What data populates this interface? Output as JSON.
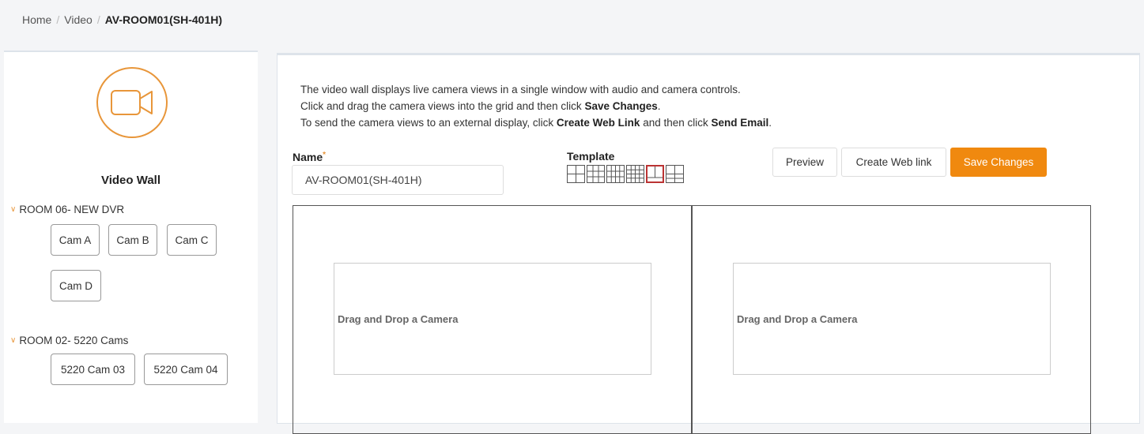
{
  "breadcrumb": {
    "home": "Home",
    "video": "Video",
    "current": "AV-ROOM01(SH-401H)"
  },
  "sidebar": {
    "title": "Video Wall",
    "rooms": [
      {
        "label": "ROOM 06- NEW DVR",
        "cams": [
          "Cam A",
          "Cam B",
          "Cam C",
          "Cam D"
        ]
      },
      {
        "label": "ROOM 02- 5220 Cams",
        "cams": [
          "5220 Cam 03",
          "5220 Cam 04"
        ]
      }
    ]
  },
  "intro": {
    "line1": "The video wall displays live camera views in a single window with audio and camera controls.",
    "line2_pre": "Click and drag the camera views into the grid and then click ",
    "line2_bold": "Save Changes",
    "line2_post": ".",
    "line3_pre": "To send the camera views to an external display, click ",
    "line3_bold1": "Create Web Link",
    "line3_mid": " and then click ",
    "line3_bold2": "Send Email",
    "line3_post": "."
  },
  "form": {
    "name_label": "Name",
    "name_required": "*",
    "name_value": "AV-ROOM01(SH-401H)",
    "template_label": "Template",
    "templates": [
      "2x2",
      "3x3",
      "4x3",
      "4x4",
      "1+2",
      "2x2-alt"
    ],
    "active_template": 4
  },
  "buttons": {
    "preview": "Preview",
    "create_link": "Create Web link",
    "save": "Save Changes"
  },
  "grid": {
    "cells": [
      "Drag and Drop a Camera",
      "Drag and Drop a Camera"
    ]
  },
  "colors": {
    "accent": "#f0890f",
    "icon_ring": "#e8963a",
    "active_template_border": "#b33333"
  },
  "icons": {
    "video_wall": "video-camera-icon",
    "room_toggle": "chevron-down-icon"
  }
}
